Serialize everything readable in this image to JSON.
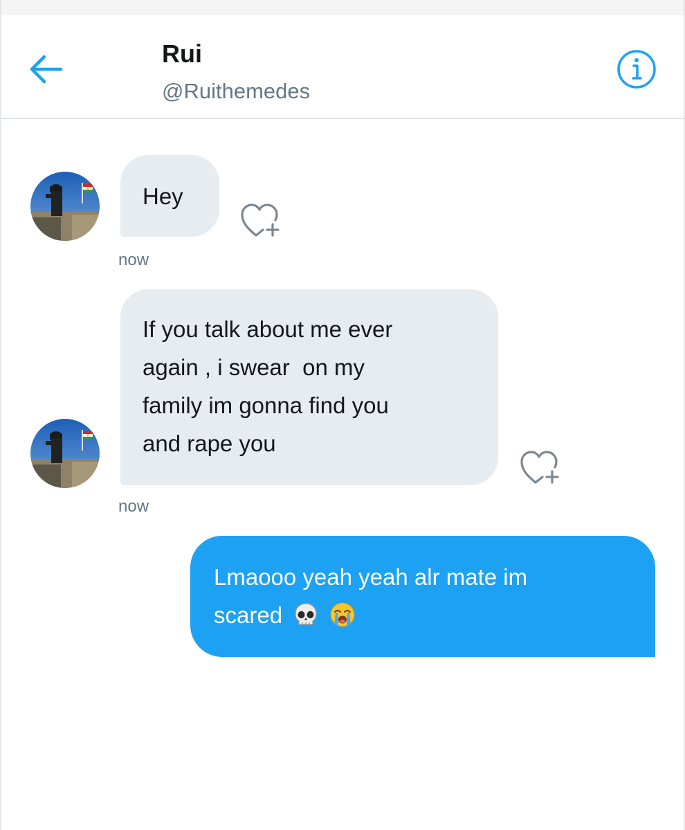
{
  "header": {
    "name": "Rui",
    "handle": "@Ruithemedes"
  },
  "icons": {
    "back": "arrow-left-icon",
    "info": "info-icon",
    "like": "heart-plus-icon"
  },
  "colors": {
    "accent": "#1da1f2",
    "incoming_bubble": "#e6ecf0",
    "muted_text": "#657786"
  },
  "messages": [
    {
      "direction": "incoming",
      "lines": [
        "Hey"
      ],
      "timestamp": "now"
    },
    {
      "direction": "incoming",
      "lines": [
        "If you talk about me ever",
        "again , i swear  on my",
        "family im gonna find you",
        "and rape you"
      ],
      "timestamp": "now"
    },
    {
      "direction": "outgoing",
      "lines": [
        "Lmaooo yeah yeah alr mate im",
        "scared"
      ],
      "emojis": [
        "skull-emoji",
        "loudly-crying-face-emoji"
      ]
    }
  ]
}
